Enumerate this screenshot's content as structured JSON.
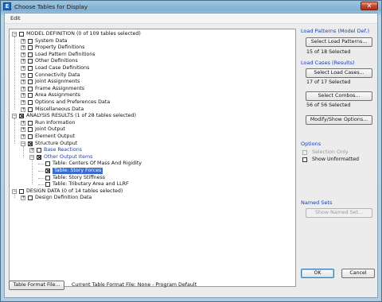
{
  "window": {
    "title": "Choose Tables for Display",
    "app_icon_glyph": "E",
    "close_glyph": "✕"
  },
  "menu": {
    "edit": "Edit"
  },
  "tree": [
    {
      "name": "tree-model-definition",
      "level": 0,
      "expander": "−",
      "checked": false,
      "label": "MODEL DEFINITION  (0 of 109 tables selected)"
    },
    {
      "name": "tree-system-data",
      "level": 1,
      "expander": "+",
      "checked": false,
      "label": "System Data"
    },
    {
      "name": "tree-property-definitions",
      "level": 1,
      "expander": "+",
      "checked": false,
      "label": "Property Definitions"
    },
    {
      "name": "tree-load-pattern-definitions",
      "level": 1,
      "expander": "+",
      "checked": false,
      "label": "Load Pattern Definitions"
    },
    {
      "name": "tree-other-definitions",
      "level": 1,
      "expander": "+",
      "checked": false,
      "label": "Other Definitions"
    },
    {
      "name": "tree-load-case-definitions",
      "level": 1,
      "expander": "+",
      "checked": false,
      "label": "Load Case Definitions"
    },
    {
      "name": "tree-connectivity-data",
      "level": 1,
      "expander": "+",
      "checked": false,
      "label": "Connectivity Data"
    },
    {
      "name": "tree-joint-assignments",
      "level": 1,
      "expander": "+",
      "checked": false,
      "label": "Joint Assignments"
    },
    {
      "name": "tree-frame-assignments",
      "level": 1,
      "expander": "+",
      "checked": false,
      "label": "Frame Assignments"
    },
    {
      "name": "tree-area-assignments",
      "level": 1,
      "expander": "+",
      "checked": false,
      "label": "Area Assignments"
    },
    {
      "name": "tree-options-preferences",
      "level": 1,
      "expander": "+",
      "checked": false,
      "label": "Options and Preferences Data"
    },
    {
      "name": "tree-miscellaneous-data",
      "level": 1,
      "expander": "+",
      "checked": false,
      "label": "Miscellaneous Data"
    },
    {
      "name": "tree-analysis-results",
      "level": 0,
      "expander": "−",
      "checked": true,
      "label": "ANALYSIS RESULTS  (1 of 28 tables selected)"
    },
    {
      "name": "tree-run-information",
      "level": 1,
      "expander": "+",
      "checked": false,
      "label": "Run Information"
    },
    {
      "name": "tree-joint-output",
      "level": 1,
      "expander": "+",
      "checked": false,
      "label": "Joint Output"
    },
    {
      "name": "tree-element-output",
      "level": 1,
      "expander": "+",
      "checked": false,
      "label": "Element Output"
    },
    {
      "name": "tree-structure-output",
      "level": 1,
      "expander": "−",
      "checked": true,
      "label": "Structure Output"
    },
    {
      "name": "tree-base-reactions",
      "level": 2,
      "expander": "+",
      "checked": false,
      "label": "Base Reactions",
      "blue": true
    },
    {
      "name": "tree-other-output-items",
      "level": 2,
      "expander": "−",
      "checked": true,
      "label": "Other Output Items",
      "blue": true
    },
    {
      "name": "tree-table-centers-of-mass",
      "level": 3,
      "expander": "",
      "checked": false,
      "label": "Table:  Centers Of Mass And Rigidity"
    },
    {
      "name": "tree-table-story-forces",
      "level": 3,
      "expander": "",
      "checked": true,
      "label": "Table:  Story Forces",
      "selected": true
    },
    {
      "name": "tree-table-story-stiffness",
      "level": 3,
      "expander": "",
      "checked": false,
      "label": "Table:  Story Stiffness"
    },
    {
      "name": "tree-table-tributary-area",
      "level": 3,
      "expander": "",
      "checked": false,
      "label": "Table:  Tributary Area and LLRF"
    },
    {
      "name": "tree-design-data",
      "level": 0,
      "expander": "−",
      "checked": false,
      "label": "DESIGN DATA  (0 of 14 tables selected)"
    },
    {
      "name": "tree-design-definition-data",
      "level": 1,
      "expander": "+",
      "checked": false,
      "label": "Design Definition Data"
    }
  ],
  "panel": {
    "load_patterns_header": "Load Patterns (Model Def.)",
    "select_load_patterns": "Select Load Patterns...",
    "load_patterns_status": "15 of 18 Selected",
    "load_cases_header": "Load Cases (Results)",
    "select_load_cases": "Select Load Cases...",
    "load_cases_status": "17 of 17 Selected",
    "select_combos": "Select Combos...",
    "combos_status": "56 of 56 Selected",
    "modify_show_options": "Modify/Show Options...",
    "options_header": "Options",
    "selection_only": "Selection Only",
    "show_unformatted": "Show Unformatted",
    "named_sets_header": "Named Sets",
    "show_named_set": "Show Named Set...",
    "ok": "OK",
    "cancel": "Cancel"
  },
  "footer": {
    "table_format_file_button": "Table Format File...",
    "current_file_text": "Current Table Format File:  None - Program Default"
  }
}
